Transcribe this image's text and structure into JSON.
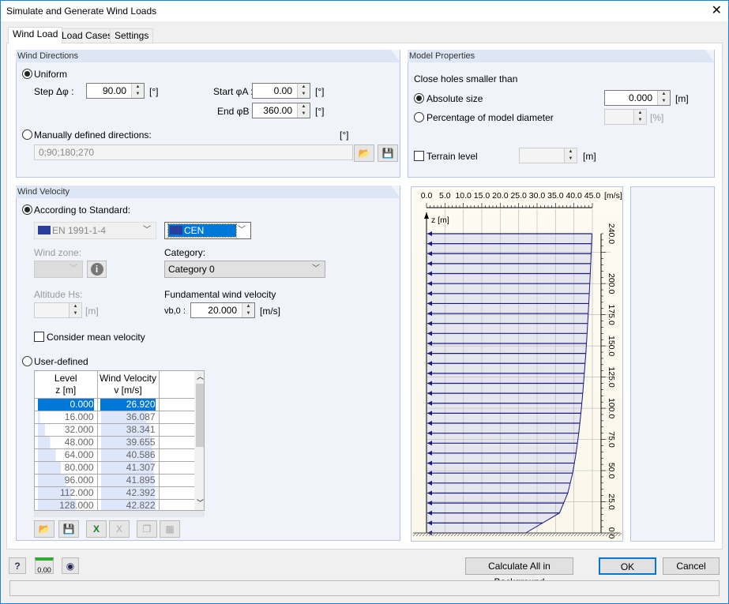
{
  "window": {
    "title": "Simulate and Generate Wind Loads",
    "close_icon": "close-icon"
  },
  "tabs": [
    {
      "label": "Wind Load",
      "active": true
    },
    {
      "label": "Load Cases"
    },
    {
      "label": "Settings"
    }
  ],
  "wind_directions": {
    "title": "Wind Directions",
    "uniform_label": "Uniform",
    "uniform_selected": true,
    "step_label": "Step Δφ :",
    "step_value": "90.00",
    "step_unit": "[°]",
    "start_label": "Start φA :",
    "start_value": "0.00",
    "start_unit": "[°]",
    "end_label": "End φB :",
    "end_value": "360.00",
    "end_unit": "[°]",
    "manual_label": "Manually defined directions:",
    "manual_unit": "[°]",
    "manual_value": "0;90;180;270"
  },
  "model_properties": {
    "title": "Model Properties",
    "close_holes_label": "Close holes smaller than",
    "absolute_label": "Absolute size",
    "absolute_value": "0.000",
    "absolute_unit": "[m]",
    "percentage_label": "Percentage of model diameter",
    "percentage_unit": "[%]",
    "terrain_label": "Terrain level",
    "terrain_unit": "[m]"
  },
  "wind_velocity": {
    "title": "Wind Velocity",
    "standard_label": "According to Standard:",
    "standard_selected": true,
    "standard_value": "EN 1991-1-4",
    "annex_value": "CEN",
    "wind_zone_label": "Wind zone:",
    "category_label": "Category:",
    "category_value": "Category 0",
    "altitude_label": "Altitude Hs:",
    "altitude_unit": "[m]",
    "fundamental_label": "Fundamental wind velocity",
    "vb0_label": "vb,0 :",
    "vb0_value": "20.000",
    "vb0_unit": "[m/s]",
    "mean_velocity_label": "Consider mean velocity",
    "user_defined_label": "User-defined",
    "table": {
      "headers": [
        [
          "Level",
          "z [m]"
        ],
        [
          "Wind Velocity",
          "v [m/s]"
        ]
      ],
      "rows": [
        [
          "0.000",
          "26.920"
        ],
        [
          "16.000",
          "36.087"
        ],
        [
          "32.000",
          "38.341"
        ],
        [
          "48.000",
          "39.655"
        ],
        [
          "64.000",
          "40.586"
        ],
        [
          "80.000",
          "41.307"
        ],
        [
          "96.000",
          "41.895"
        ],
        [
          "112.000",
          "42.392"
        ],
        [
          "128.000",
          "42.822"
        ]
      ]
    }
  },
  "chart_data": {
    "type": "line",
    "x_ticks": [
      "0.0",
      "5.0",
      "10.0",
      "15.0",
      "20.0",
      "25.0",
      "30.0",
      "35.0",
      "40.0",
      "45.0"
    ],
    "x_unit": "[m/s]",
    "y_label": "z [m]",
    "y_ticks": [
      "0.0",
      "25.0",
      "50.0",
      "75.0",
      "100.0",
      "125.0",
      "150.0",
      "175.0",
      "200.0",
      "240.0"
    ],
    "xlim": [
      0,
      45
    ],
    "ylim": [
      0,
      240
    ],
    "grid": true,
    "profile": {
      "z": [
        0,
        16,
        32,
        48,
        64,
        80,
        96,
        112,
        128,
        144,
        160,
        176,
        192,
        208,
        224,
        240
      ],
      "v": [
        26.92,
        36.087,
        38.341,
        39.655,
        40.586,
        41.307,
        41.895,
        42.392,
        42.822,
        43.23,
        43.57,
        43.88,
        44.17,
        44.43,
        44.67,
        44.89
      ]
    },
    "arrow_step_z": 8,
    "colors": {
      "line": "#1a1a80",
      "fill": "#e6e6ef",
      "grid": "#bdbdbd"
    }
  },
  "footer": {
    "calc_label": "Calculate All in Background",
    "ok_label": "OK",
    "cancel_label": "Cancel",
    "units_icon_text": "0.00"
  }
}
